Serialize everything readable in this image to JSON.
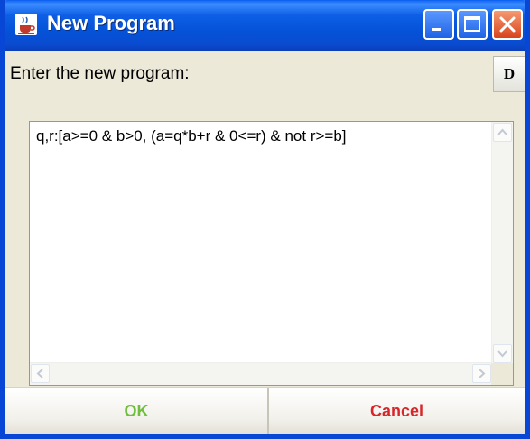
{
  "window": {
    "title": "New Program",
    "controls": {
      "minimize": "minimize-icon",
      "maximize": "maximize-icon",
      "close": "close-icon"
    }
  },
  "prompt": {
    "label": "Enter the new program:",
    "side_button": "D"
  },
  "editor": {
    "value": "q,r:[a>=0 & b>0, (a=q*b+r & 0<=r) & not r>=b]"
  },
  "buttons": {
    "ok": "OK",
    "cancel": "Cancel"
  },
  "colors": {
    "title_bar": "#0453d8",
    "close_button": "#d9441c",
    "ok_text": "#6fbe3e",
    "cancel_text": "#d8262b"
  }
}
